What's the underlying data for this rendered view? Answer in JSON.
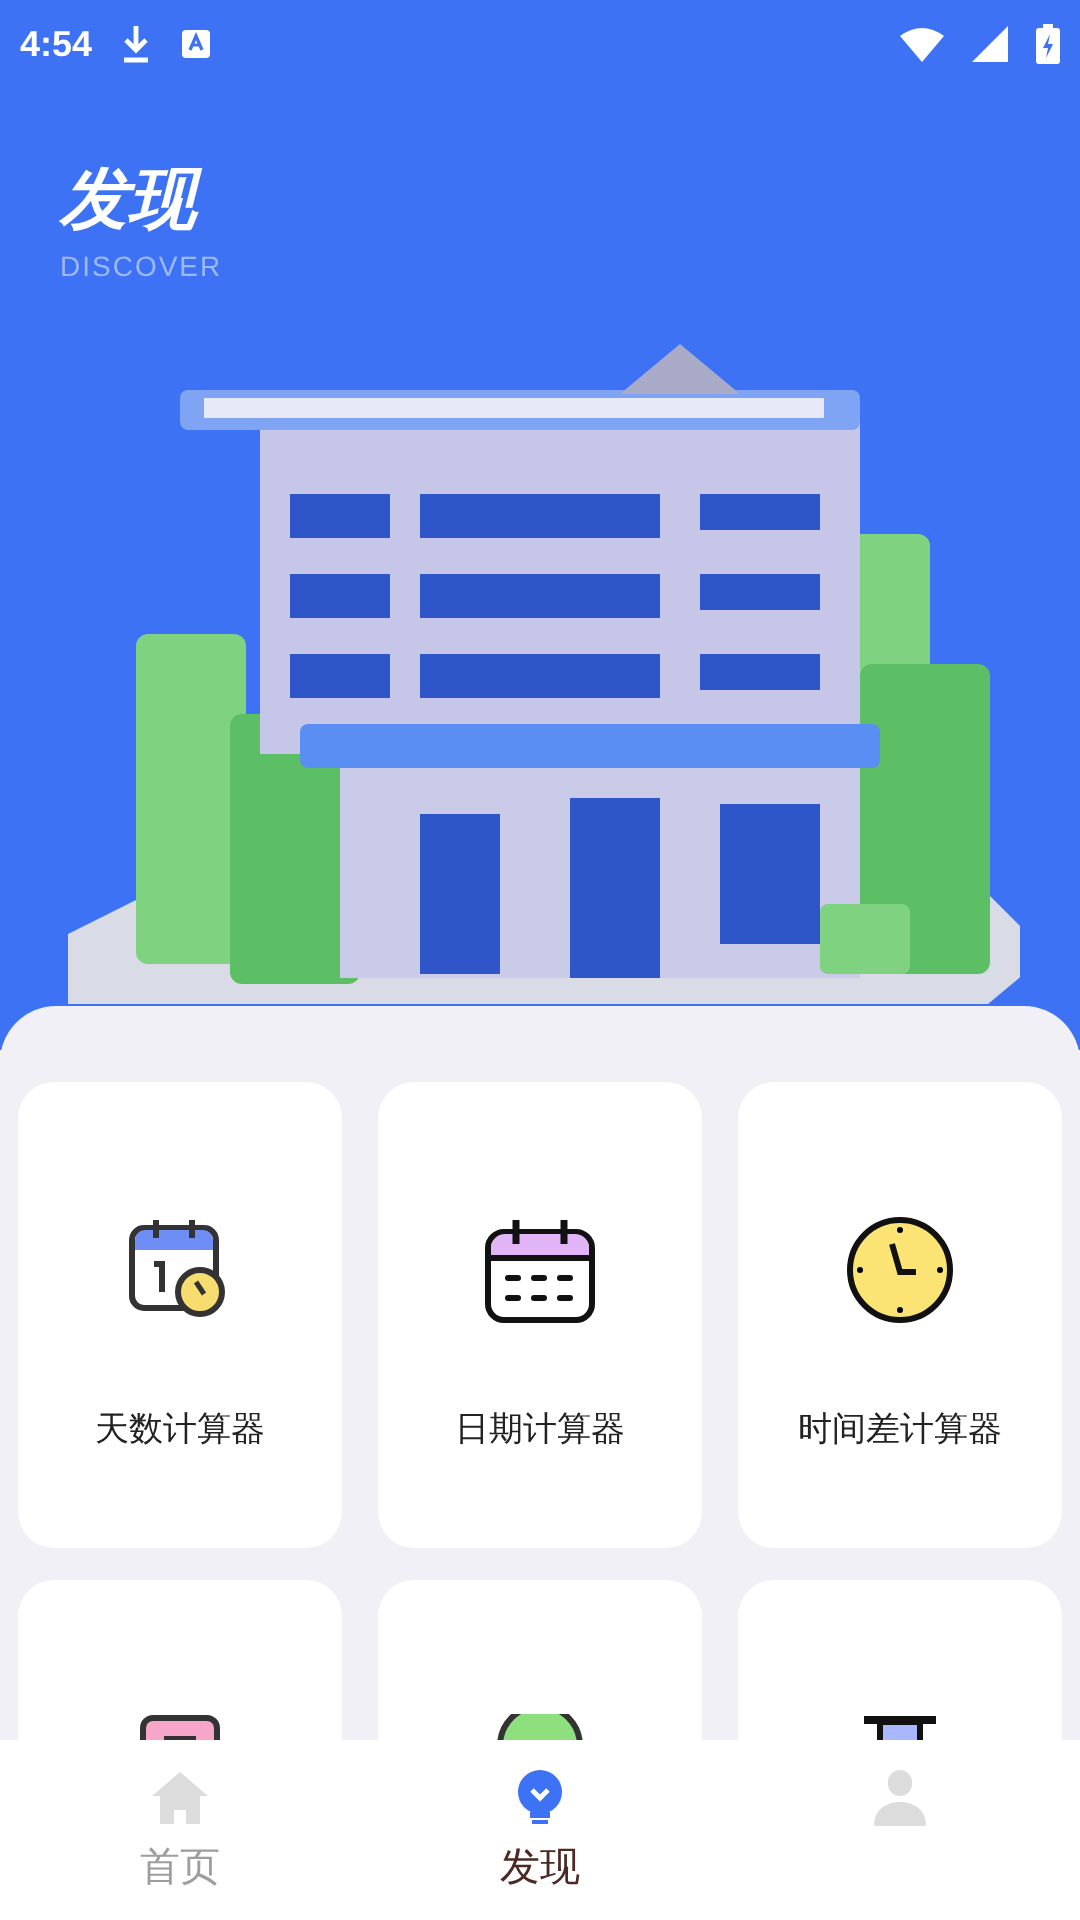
{
  "status_bar": {
    "time": "4:54"
  },
  "header": {
    "title": "发现",
    "subtitle": "DISCOVER"
  },
  "tools": [
    {
      "kind": "days",
      "label": "天数计算器"
    },
    {
      "kind": "date",
      "label": "日期计算器"
    },
    {
      "kind": "time_diff",
      "label": "时间差计算器"
    },
    {
      "kind": "pink"
    },
    {
      "kind": "green"
    },
    {
      "kind": "blue"
    }
  ],
  "tabs": [
    {
      "label": "首页",
      "selected": false
    },
    {
      "label": "发现",
      "selected": true
    },
    {
      "selected": false
    }
  ]
}
